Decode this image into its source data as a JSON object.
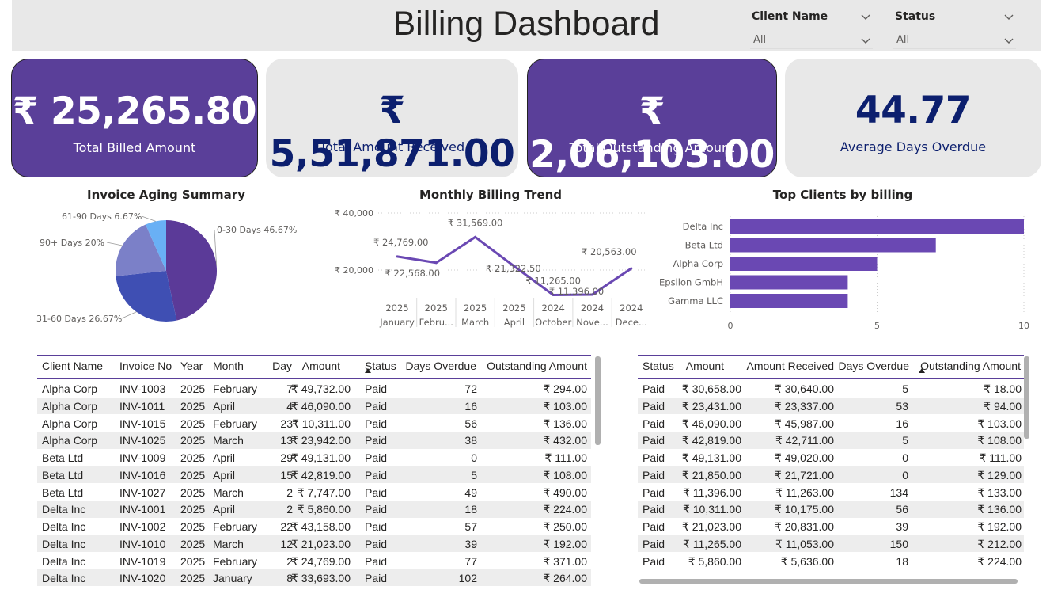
{
  "header": {
    "title": "Billing Dashboard",
    "slicers": [
      {
        "label": "Client Name",
        "value": "All"
      },
      {
        "label": "Status",
        "value": "All"
      }
    ]
  },
  "kpis": [
    {
      "value": "₹ 25,265.80",
      "caption": "Total Billed Amount",
      "style": "dark"
    },
    {
      "value": "₹ 5,51,871.00",
      "caption": "Total Amount Received",
      "style": "light"
    },
    {
      "value": "₹ 2,06,103.00",
      "caption": "Total Outstanding Amount",
      "style": "dark"
    },
    {
      "value": "44.77",
      "caption": "Average Days Overdue",
      "style": "light"
    }
  ],
  "colors": {
    "accent": "#5a3f99",
    "kpi_text_dark_bg": "#ffffff",
    "kpi_text_light_bg": "#0c1f6e",
    "bar": "#6a48b3"
  },
  "chart_data": [
    {
      "type": "pie",
      "title": "Invoice Aging Summary",
      "categories": [
        "0-30 Days",
        "31-60 Days",
        "90+ Days",
        "61-90 Days"
      ],
      "values": [
        46.67,
        26.67,
        20,
        6.67
      ],
      "labels": [
        "0-30 Days 46.67%",
        "31-60 Days 26.67%",
        "90+ Days 20%",
        "61-90 Days 6.67%"
      ],
      "colors": [
        "#5b3a98",
        "#3f4fb3",
        "#7b80c8",
        "#69b0f5"
      ]
    },
    {
      "type": "line",
      "title": "Monthly Billing Trend",
      "x_years": [
        "2025",
        "2025",
        "2025",
        "2025",
        "2024",
        "2024",
        "2024"
      ],
      "x_months": [
        "January",
        "Febru...",
        "March",
        "April",
        "October",
        "Nove...",
        "Dece..."
      ],
      "values": [
        24769,
        22568,
        31569,
        21322.5,
        11265,
        11396,
        20563
      ],
      "data_labels": [
        "₹ 24,769.00",
        "₹ 22,568.00",
        "₹ 31,569.00",
        "₹ 21,322.50",
        "₹ 11,265.00",
        "₹ 11,396.00",
        "₹ 20,563.00"
      ],
      "y_ticks": [
        "₹ 40,000",
        "₹ 20,000"
      ],
      "ylim": [
        0,
        40000
      ]
    },
    {
      "type": "bar",
      "title": "Top Clients by billing",
      "categories": [
        "Delta Inc",
        "Beta Ltd",
        "Alpha Corp",
        "Epsilon GmbH",
        "Gamma LLC"
      ],
      "values": [
        10,
        7,
        5,
        4,
        4
      ],
      "x_ticks": [
        "0",
        "5",
        "10"
      ],
      "xlim": [
        0,
        10
      ]
    }
  ],
  "table1": {
    "columns": [
      "Client Name",
      "Invoice No",
      "Year",
      "Month",
      "Day",
      "Amount",
      "Status",
      "Days Overdue",
      "Outstanding Amount"
    ],
    "rows": [
      [
        "Alpha Corp",
        "INV-1003",
        "2025",
        "February",
        "7",
        "₹ 49,732.00",
        "Paid",
        "72",
        "₹ 294.00"
      ],
      [
        "Alpha Corp",
        "INV-1011",
        "2025",
        "April",
        "4",
        "₹ 46,090.00",
        "Paid",
        "16",
        "₹ 103.00"
      ],
      [
        "Alpha Corp",
        "INV-1015",
        "2025",
        "February",
        "23",
        "₹ 10,311.00",
        "Paid",
        "56",
        "₹ 136.00"
      ],
      [
        "Alpha Corp",
        "INV-1025",
        "2025",
        "March",
        "13",
        "₹ 23,942.00",
        "Paid",
        "38",
        "₹ 432.00"
      ],
      [
        "Beta Ltd",
        "INV-1009",
        "2025",
        "April",
        "29",
        "₹ 49,131.00",
        "Paid",
        "0",
        "₹ 111.00"
      ],
      [
        "Beta Ltd",
        "INV-1016",
        "2025",
        "April",
        "15",
        "₹ 42,819.00",
        "Paid",
        "5",
        "₹ 108.00"
      ],
      [
        "Beta Ltd",
        "INV-1027",
        "2025",
        "March",
        "2",
        "₹ 7,747.00",
        "Paid",
        "49",
        "₹ 490.00"
      ],
      [
        "Delta Inc",
        "INV-1001",
        "2025",
        "April",
        "2",
        "₹ 5,860.00",
        "Paid",
        "18",
        "₹ 224.00"
      ],
      [
        "Delta Inc",
        "INV-1002",
        "2025",
        "February",
        "22",
        "₹ 43,158.00",
        "Paid",
        "57",
        "₹ 250.00"
      ],
      [
        "Delta Inc",
        "INV-1010",
        "2025",
        "March",
        "12",
        "₹ 21,023.00",
        "Paid",
        "39",
        "₹ 192.00"
      ],
      [
        "Delta Inc",
        "INV-1019",
        "2025",
        "February",
        "2",
        "₹ 24,769.00",
        "Paid",
        "77",
        "₹ 371.00"
      ],
      [
        "Delta Inc",
        "INV-1020",
        "2025",
        "January",
        "8",
        "₹ 33,693.00",
        "Paid",
        "102",
        "₹ 264.00"
      ]
    ]
  },
  "table2": {
    "columns": [
      "Status",
      "Amount",
      "Amount Received",
      "Days Overdue",
      "Outstanding Amount"
    ],
    "rows": [
      [
        "Paid",
        "₹ 30,658.00",
        "₹ 30,640.00",
        "5",
        "₹ 18.00"
      ],
      [
        "Paid",
        "₹ 23,431.00",
        "₹ 23,337.00",
        "53",
        "₹ 94.00"
      ],
      [
        "Paid",
        "₹ 46,090.00",
        "₹ 45,987.00",
        "16",
        "₹ 103.00"
      ],
      [
        "Paid",
        "₹ 42,819.00",
        "₹ 42,711.00",
        "5",
        "₹ 108.00"
      ],
      [
        "Paid",
        "₹ 49,131.00",
        "₹ 49,020.00",
        "0",
        "₹ 111.00"
      ],
      [
        "Paid",
        "₹ 21,850.00",
        "₹ 21,721.00",
        "0",
        "₹ 129.00"
      ],
      [
        "Paid",
        "₹ 11,396.00",
        "₹ 11,263.00",
        "134",
        "₹ 133.00"
      ],
      [
        "Paid",
        "₹ 10,311.00",
        "₹ 10,175.00",
        "56",
        "₹ 136.00"
      ],
      [
        "Paid",
        "₹ 21,023.00",
        "₹ 20,831.00",
        "39",
        "₹ 192.00"
      ],
      [
        "Paid",
        "₹ 11,265.00",
        "₹ 11,053.00",
        "150",
        "₹ 212.00"
      ],
      [
        "Paid",
        "₹ 5,860.00",
        "₹ 5,636.00",
        "18",
        "₹ 224.00"
      ]
    ]
  }
}
